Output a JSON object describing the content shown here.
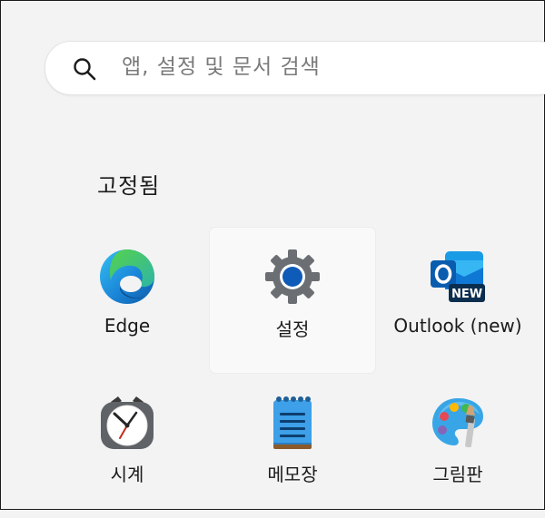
{
  "search": {
    "placeholder": "앱, 설정 및 문서 검색",
    "value": ""
  },
  "pinned": {
    "title": "고정됨",
    "apps": [
      {
        "label": "Edge",
        "icon": "edge-icon"
      },
      {
        "label": "설정",
        "icon": "settings-gear-icon"
      },
      {
        "label": "Outlook (new)",
        "icon": "outlook-icon",
        "badge": "NEW"
      },
      {
        "label": "시계",
        "icon": "clock-icon"
      },
      {
        "label": "메모장",
        "icon": "notepad-icon"
      },
      {
        "label": "그림판",
        "icon": "paint-icon"
      }
    ]
  },
  "colors": {
    "background": "#f3f3f3",
    "search_bg": "#ffffff",
    "text": "#1b1b1b",
    "placeholder": "#7a7a7a",
    "selected_tile": "#f9f9f9"
  }
}
